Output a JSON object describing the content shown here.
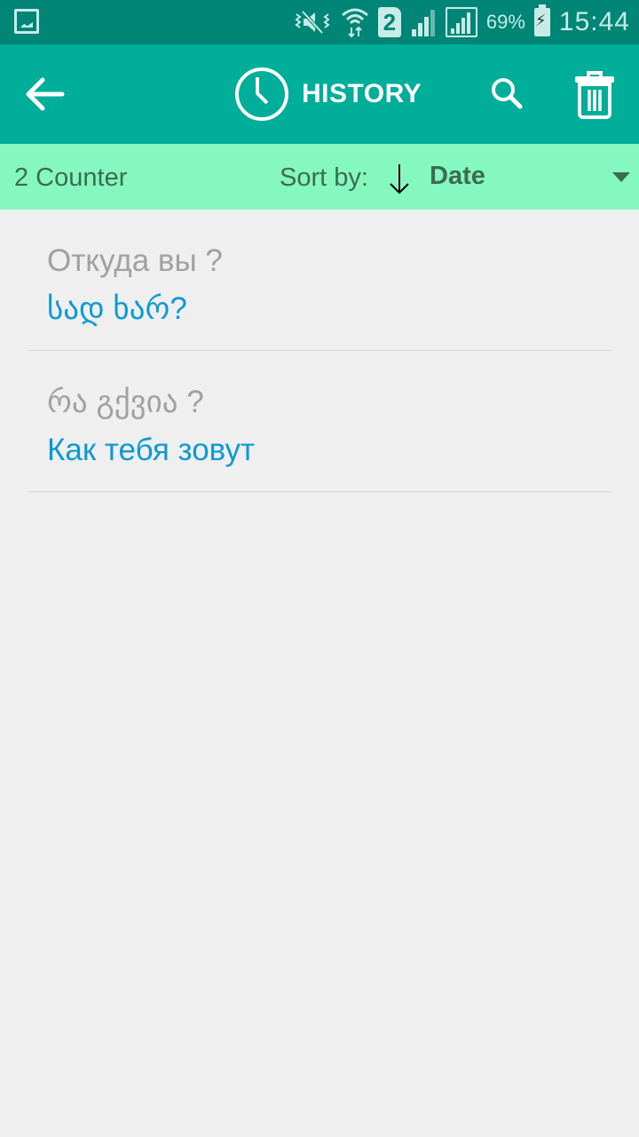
{
  "status_bar": {
    "icons": [
      "gallery-icon",
      "mute-vibrate-icon",
      "wifi-icon",
      "sim2-icon",
      "signal-icon",
      "signal-roaming-icon",
      "battery-charging-icon"
    ],
    "sim_label": "2",
    "battery": "69%",
    "time": "15:44"
  },
  "toolbar": {
    "back_icon": "arrow-left-icon",
    "title_icon": "clock-icon",
    "title": "HISTORY",
    "search_icon": "search-icon",
    "delete_icon": "trash-icon"
  },
  "sort_bar": {
    "counter": "2 Counter",
    "sort_label": "Sort by:",
    "sort_direction_icon": "arrow-down-icon",
    "sort_value": "Date",
    "dropdown_icon": "triangle-down-icon"
  },
  "colors": {
    "status_bar": "#008577",
    "toolbar": "#00ae9a",
    "sort_bar": "#85f8bf",
    "sort_text": "#3b6d50",
    "source_text": "#a1a1a1",
    "target_text": "#0e9ad0",
    "background": "#efefef"
  },
  "history": [
    {
      "source": "Откуда вы ?",
      "target": "სად ხარ?"
    },
    {
      "source": "რა გქვია ?",
      "target": "Как тебя зовут"
    }
  ]
}
